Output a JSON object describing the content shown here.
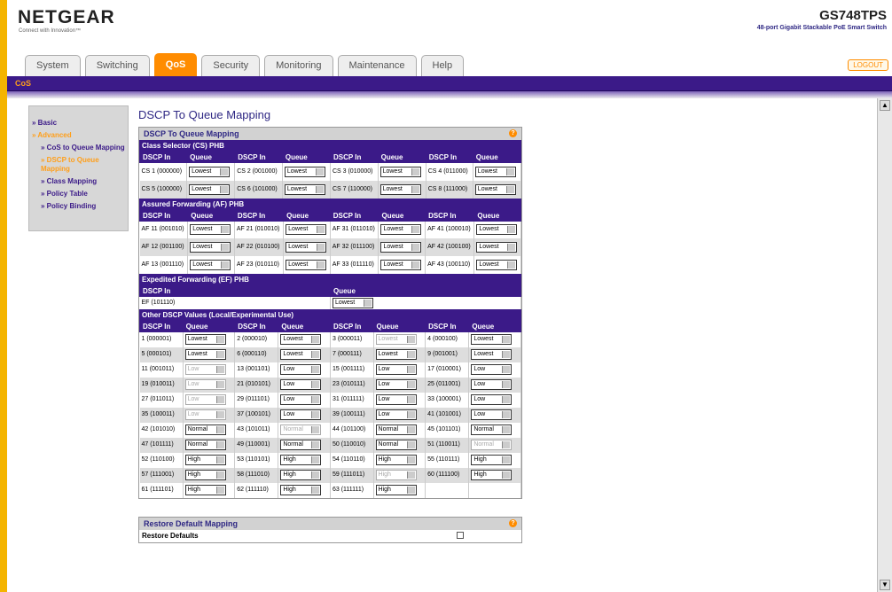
{
  "header": {
    "logo": "NETGEAR",
    "tagline": "Connect with Innovation™",
    "model": "GS748TPS",
    "model_desc": "48-port Gigabit Stackable PoE Smart Switch",
    "logout": "LOGOUT"
  },
  "tabs": [
    "System",
    "Switching",
    "QoS",
    "Security",
    "Monitoring",
    "Maintenance",
    "Help"
  ],
  "subnav": "CoS",
  "sidebar": [
    {
      "label": "» Basic",
      "hl": false,
      "sub": false
    },
    {
      "label": "» Advanced",
      "hl": true,
      "sub": false
    },
    {
      "label": "» CoS to Queue Mapping",
      "hl": false,
      "sub": true
    },
    {
      "label": "» DSCP to Queue Mapping",
      "hl": true,
      "sub": true
    },
    {
      "label": "» Class Mapping",
      "hl": false,
      "sub": true
    },
    {
      "label": "» Policy Table",
      "hl": false,
      "sub": true
    },
    {
      "label": "» Policy Binding",
      "hl": false,
      "sub": true
    }
  ],
  "page_title": "DSCP To Queue Mapping",
  "panel_title": "DSCP To Queue Mapping",
  "cols": {
    "dscp": "DSCP In",
    "queue": "Queue"
  },
  "cs": {
    "title": "Class Selector (CS) PHB",
    "rows": [
      [
        [
          "CS 1 (000000)",
          "Lowest"
        ],
        [
          "CS 2 (001000)",
          "Lowest"
        ],
        [
          "CS 3 (010000)",
          "Lowest"
        ],
        [
          "CS 4 (011000)",
          "Lowest"
        ]
      ],
      [
        [
          "CS 5 (100000)",
          "Lowest"
        ],
        [
          "CS 6 (101000)",
          "Lowest"
        ],
        [
          "CS 7 (110000)",
          "Lowest"
        ],
        [
          "CS 8 (111000)",
          "Lowest"
        ]
      ]
    ]
  },
  "af": {
    "title": "Assured Forwarding (AF) PHB",
    "rows": [
      [
        [
          "AF 11 (001010)",
          "Lowest"
        ],
        [
          "AF 21 (010010)",
          "Lowest"
        ],
        [
          "AF 31 (011010)",
          "Lowest"
        ],
        [
          "AF 41 (100010)",
          "Lowest"
        ]
      ],
      [
        [
          "AF 12 (001100)",
          "Lowest"
        ],
        [
          "AF 22 (010100)",
          "Lowest"
        ],
        [
          "AF 32 (011100)",
          "Lowest"
        ],
        [
          "AF 42 (100100)",
          "Lowest"
        ]
      ],
      [
        [
          "AF 13 (001110)",
          "Lowest"
        ],
        [
          "AF 23 (010110)",
          "Lowest"
        ],
        [
          "AF 33 (011110)",
          "Lowest"
        ],
        [
          "AF 43 (100110)",
          "Lowest"
        ]
      ]
    ]
  },
  "ef": {
    "title": "Expedited Forwarding (EF) PHB",
    "dscp": "EF (101110)",
    "queue": "Lowest"
  },
  "other": {
    "title": "Other DSCP Values (Local/Experimental Use)",
    "rows": [
      [
        [
          "1 (000001)",
          "Lowest",
          0
        ],
        [
          "2 (000010)",
          "Lowest",
          0
        ],
        [
          "3 (000011)",
          "Lowest",
          1
        ],
        [
          "4 (000100)",
          "Lowest",
          0
        ]
      ],
      [
        [
          "5 (000101)",
          "Lowest",
          0
        ],
        [
          "6 (000110)",
          "Lowest",
          0
        ],
        [
          "7 (000111)",
          "Lowest",
          0
        ],
        [
          "9 (001001)",
          "Lowest",
          0
        ]
      ],
      [
        [
          "11 (001011)",
          "Low",
          1
        ],
        [
          "13 (001101)",
          "Low",
          0
        ],
        [
          "15 (001111)",
          "Low",
          0
        ],
        [
          "17 (010001)",
          "Low",
          0
        ]
      ],
      [
        [
          "19 (010011)",
          "Low",
          1
        ],
        [
          "21 (010101)",
          "Low",
          0
        ],
        [
          "23 (010111)",
          "Low",
          0
        ],
        [
          "25 (011001)",
          "Low",
          0
        ]
      ],
      [
        [
          "27 (011011)",
          "Low",
          1
        ],
        [
          "29 (011101)",
          "Low",
          0
        ],
        [
          "31 (011111)",
          "Low",
          0
        ],
        [
          "33 (100001)",
          "Low",
          0
        ]
      ],
      [
        [
          "35 (100011)",
          "Low",
          1
        ],
        [
          "37 (100101)",
          "Low",
          0
        ],
        [
          "39 (100111)",
          "Low",
          0
        ],
        [
          "41 (101001)",
          "Low",
          0
        ]
      ],
      [
        [
          "42 (101010)",
          "Normal",
          0
        ],
        [
          "43 (101011)",
          "Normal",
          1
        ],
        [
          "44 (101100)",
          "Normal",
          0
        ],
        [
          "45 (101101)",
          "Normal",
          0
        ]
      ],
      [
        [
          "47 (101111)",
          "Normal",
          0
        ],
        [
          "49 (110001)",
          "Normal",
          0
        ],
        [
          "50 (110010)",
          "Normal",
          0
        ],
        [
          "51 (110011)",
          "Normal",
          1
        ]
      ],
      [
        [
          "52 (110100)",
          "High",
          0
        ],
        [
          "53 (110101)",
          "High",
          0
        ],
        [
          "54 (110110)",
          "High",
          0
        ],
        [
          "55 (110111)",
          "High",
          0
        ]
      ],
      [
        [
          "57 (111001)",
          "High",
          0
        ],
        [
          "58 (111010)",
          "High",
          0
        ],
        [
          "59 (111011)",
          "High",
          1
        ],
        [
          "60 (111100)",
          "High",
          0
        ]
      ],
      [
        [
          "61 (111101)",
          "High",
          0
        ],
        [
          "62 (111110)",
          "High",
          0
        ],
        [
          "63 (111111)",
          "High",
          0
        ],
        [
          "",
          null,
          0
        ]
      ]
    ]
  },
  "restore": {
    "title": "Restore Default Mapping",
    "label": "Restore Defaults"
  }
}
